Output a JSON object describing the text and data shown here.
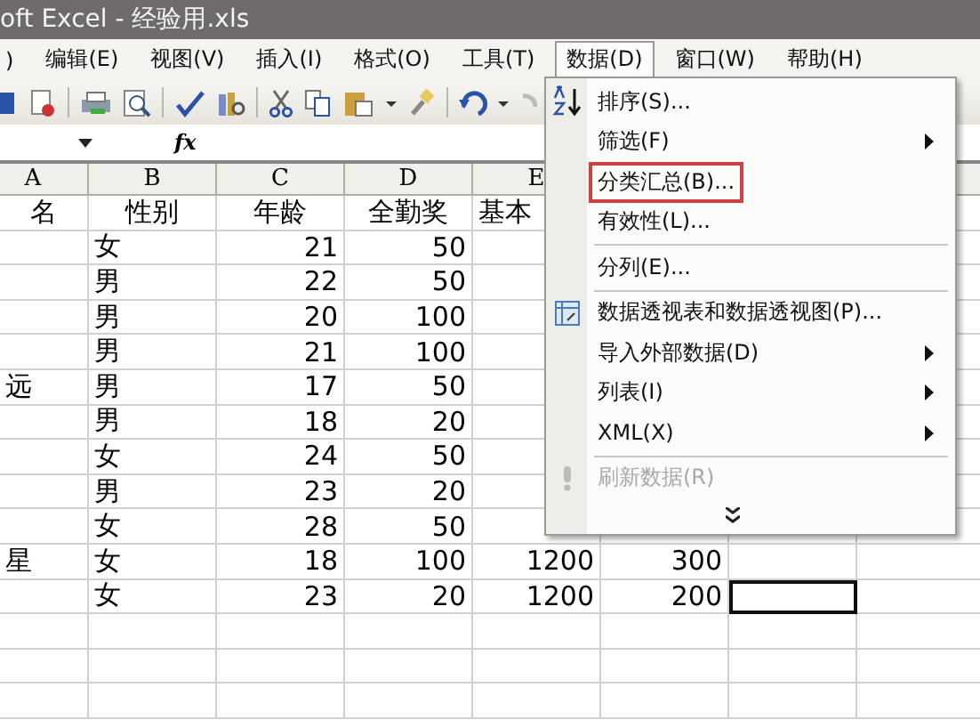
{
  "window": {
    "title": "oft Excel - 经验用.xls"
  },
  "menu_bar": [
    {
      "label": ")",
      "selected": false
    },
    {
      "label": "编辑(E)",
      "selected": false
    },
    {
      "label": "视图(V)",
      "selected": false
    },
    {
      "label": "插入(I)",
      "selected": false
    },
    {
      "label": "格式(O)",
      "selected": false
    },
    {
      "label": "工具(T)",
      "selected": false
    },
    {
      "label": "数据(D)",
      "selected": true
    },
    {
      "label": "窗口(W)",
      "selected": false
    },
    {
      "label": "帮助(H)",
      "selected": false
    }
  ],
  "formula_bar": {
    "fx": "fx"
  },
  "columns": [
    "A",
    "B",
    "C",
    "D",
    "E"
  ],
  "rows": [
    {
      "kind": "header",
      "A": "名",
      "B": "性别",
      "C": "年龄",
      "D": "全勤奖",
      "E": "基本"
    },
    {
      "kind": "data",
      "B": "女",
      "C": "21",
      "D": "50"
    },
    {
      "kind": "data",
      "B": "男",
      "C": "22",
      "D": "50"
    },
    {
      "kind": "data",
      "B": "男",
      "C": "20",
      "D": "100"
    },
    {
      "kind": "data",
      "B": "男",
      "C": "21",
      "D": "100"
    },
    {
      "kind": "data",
      "A": "远",
      "B": "男",
      "C": "17",
      "D": "50"
    },
    {
      "kind": "data",
      "B": "男",
      "C": "18",
      "D": "20"
    },
    {
      "kind": "data",
      "B": "女",
      "C": "24",
      "D": "50"
    },
    {
      "kind": "data",
      "B": "男",
      "C": "23",
      "D": "20"
    },
    {
      "kind": "data",
      "B": "女",
      "C": "28",
      "D": "50"
    },
    {
      "kind": "data",
      "selected": false,
      "A": "星",
      "B": "女",
      "C": "18",
      "D": "100",
      "E": "1200",
      "F": "300"
    },
    {
      "kind": "data",
      "selected": true,
      "B": "女",
      "C": "23",
      "D": "20",
      "E": "1200",
      "F": "200"
    }
  ],
  "dropdown": [
    {
      "kind": "item",
      "label": "排序(S)...",
      "submenu": false,
      "highlighted": false,
      "disabled": false
    },
    {
      "kind": "item",
      "label": "筛选(F)",
      "submenu": true,
      "highlighted": false,
      "disabled": false
    },
    {
      "kind": "item",
      "label": "分类汇总(B)...",
      "submenu": false,
      "highlighted": true,
      "disabled": false
    },
    {
      "kind": "item",
      "label": "有效性(L)...",
      "submenu": false,
      "highlighted": false,
      "disabled": false
    },
    {
      "kind": "separator"
    },
    {
      "kind": "item",
      "label": "分列(E)...",
      "submenu": false,
      "highlighted": false,
      "disabled": false
    },
    {
      "kind": "separator"
    },
    {
      "kind": "item",
      "label": "数据透视表和数据透视图(P)...",
      "submenu": false,
      "highlighted": false,
      "disabled": false
    },
    {
      "kind": "item",
      "label": "导入外部数据(D)",
      "submenu": true,
      "highlighted": false,
      "disabled": false
    },
    {
      "kind": "item",
      "label": "列表(I)",
      "submenu": true,
      "highlighted": false,
      "disabled": false
    },
    {
      "kind": "item",
      "label": "XML(X)",
      "submenu": true,
      "highlighted": false,
      "disabled": false
    },
    {
      "kind": "separator"
    },
    {
      "kind": "item",
      "label": "刷新数据(R)",
      "submenu": false,
      "highlighted": false,
      "disabled": true
    },
    {
      "kind": "expand"
    }
  ]
}
